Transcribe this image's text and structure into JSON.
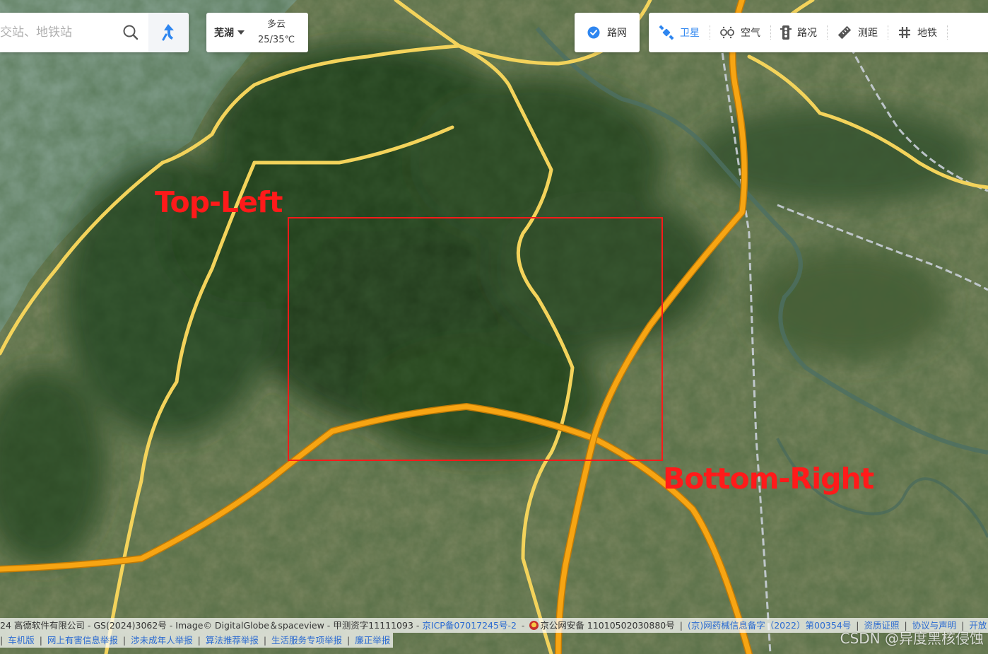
{
  "search": {
    "placeholder": "交站、地铁站"
  },
  "weather": {
    "city": "芜湖",
    "condition": "多云",
    "temperature": "25/35℃"
  },
  "layers": {
    "roadnet_label": "路网",
    "tools": [
      {
        "label": "卫星",
        "icon": "satellite-icon",
        "active": true
      },
      {
        "label": "空气",
        "icon": "air-icon",
        "active": false
      },
      {
        "label": "路况",
        "icon": "traffic-light-icon",
        "active": false
      },
      {
        "label": "测距",
        "icon": "ruler-icon",
        "active": false
      },
      {
        "label": "地铁",
        "icon": "subway-icon",
        "active": false
      }
    ]
  },
  "annotations": {
    "top_left": "Top-Left",
    "bottom_right": "Bottom-Right"
  },
  "footer": {
    "copyright": "24 高德软件有限公司 - GS(2024)3062号 - Image© DigitalGlobe＆spaceview - 甲测资字11111093 -",
    "icp": "京ICP备07017245号-2",
    "police": "京公网安备 11010502030880号",
    "medical": "(京)网药械信息备字（2022）第00354号",
    "license": "资质证照",
    "agreement": "协议与声明",
    "open": "开放",
    "links2": [
      "车机版",
      "网上有害信息举报",
      "涉未成年人举报",
      "算法推荐举报",
      "生活服务专项举报",
      "廉正举报"
    ]
  },
  "watermark": "CSDN @异度黑核侵蚀",
  "colors": {
    "annotation_red": "#ff1a1a",
    "link_blue": "#2a6ad0",
    "active_blue": "#2e86f0",
    "highway_orange": "#f7a513",
    "road_yellow": "#f3d35b"
  }
}
